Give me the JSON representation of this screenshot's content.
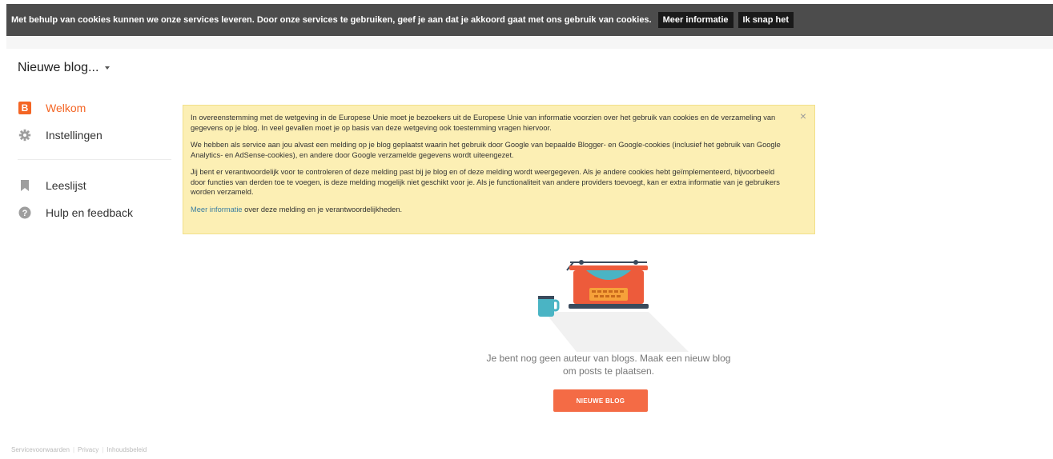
{
  "cookie_bar": {
    "text": "Met behulp van cookies kunnen we onze services leveren. Door onze services te gebruiken, geef je aan dat je akkoord gaat met ons gebruik van cookies.",
    "more_info": "Meer informatie",
    "accept": "Ik snap het"
  },
  "blog_selector": {
    "label": "Nieuwe blog..."
  },
  "sidebar": {
    "items": [
      {
        "label": "Welkom",
        "icon": "blogger-icon",
        "active": true
      },
      {
        "label": "Instellingen",
        "icon": "gear-icon"
      },
      {
        "label": "Leeslijst",
        "icon": "bookmark-icon"
      },
      {
        "label": "Hulp en feedback",
        "icon": "help-icon"
      }
    ]
  },
  "notice": {
    "p1": "In overeenstemming met de wetgeving in de Europese Unie moet je bezoekers uit de Europese Unie van informatie voorzien over het gebruik van cookies en de verzameling van gegevens op je blog. In veel gevallen moet je op basis van deze wetgeving ook toestemming vragen hiervoor.",
    "p2": "We hebben als service aan jou alvast een melding op je blog geplaatst waarin het gebruik door Google van bepaalde Blogger- en Google-cookies (inclusief het gebruik van Google Analytics- en AdSense-cookies), en andere door Google verzamelde gegevens wordt uiteengezet.",
    "p3": "Jij bent er verantwoordelijk voor te controleren of deze melding past bij je blog en of deze melding wordt weergegeven. Als je andere cookies hebt geïmplementeerd, bijvoorbeeld door functies van derden toe te voegen, is deze melding mogelijk niet geschikt voor je. Als je functionaliteit van andere providers toevoegt, kan er extra informatie van je gebruikers worden verzameld.",
    "link": "Meer informatie",
    "link_suffix": " over deze melding en je verantwoordelijkheden.",
    "close": "×"
  },
  "empty_state": {
    "message": "Je bent nog geen auteur van blogs. Maak een nieuw blog om posts te plaatsen.",
    "button": "NIEUWE BLOG"
  },
  "footer": {
    "links": [
      "Servicevoorwaarden",
      "Privacy",
      "Inhoudsbeleid"
    ]
  },
  "colors": {
    "accent": "#f46524",
    "cookie_bar": "#4c4c4c",
    "notice_bg": "#fcefb4",
    "button": "#f46b45"
  }
}
